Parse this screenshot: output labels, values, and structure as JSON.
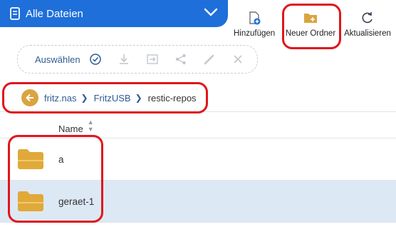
{
  "header": {
    "title": "Alle Dateien",
    "icon": "nas-device-icon"
  },
  "toolbar": {
    "add_label": "Hinzufügen",
    "new_folder_label": "Neuer Ordner",
    "refresh_label": "Aktualisieren"
  },
  "selection_bar": {
    "select_label": "Auswählen"
  },
  "breadcrumb": {
    "items": [
      "fritz.nas",
      "FritzUSB",
      "restic-repos"
    ]
  },
  "table": {
    "column_name": "Name",
    "rows": [
      {
        "name": "a",
        "selected": false
      },
      {
        "name": "geraet-1",
        "selected": true
      }
    ]
  },
  "colors": {
    "header_blue": "#1e6fd9",
    "folder_gold": "#e0a93a",
    "selected_row": "#dde8f5",
    "annotation_red": "#e0161b",
    "link_blue": "#2f5c96"
  }
}
